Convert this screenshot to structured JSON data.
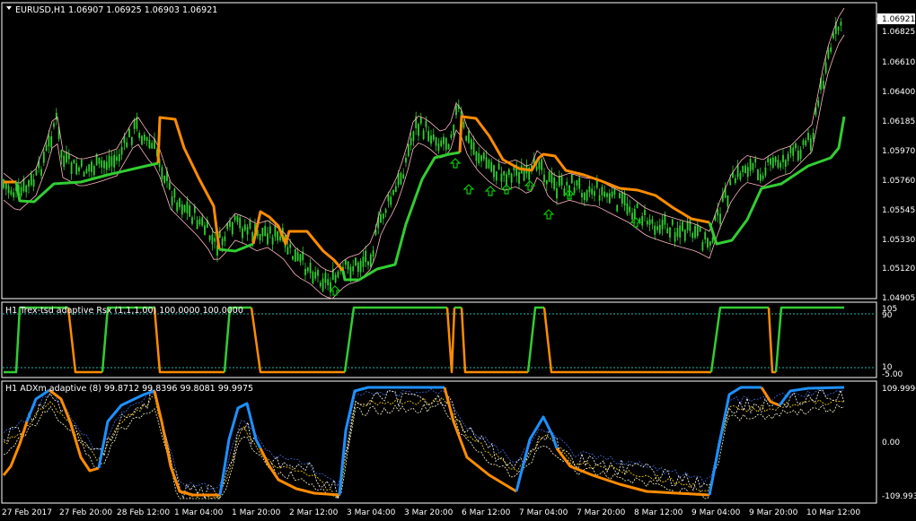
{
  "main": {
    "header": "EURUSD,H1  1.06907 1.06925 1.06903 1.06921",
    "price_labels": [
      "1.06921",
      "1.06825",
      "1.06610",
      "1.06400",
      "1.06185",
      "1.05970",
      "1.05760",
      "1.05545",
      "1.05330",
      "1.05120",
      "1.04905"
    ],
    "current_price": "1.06921"
  },
  "rsx": {
    "header": "H1 Trex-tsd adaptive Rsx (1,1,1.00) 100.0000 100.0000",
    "levels": [
      "105",
      "90",
      "10",
      "-5.00"
    ]
  },
  "adx": {
    "header": "H1 ADXm adaptive (8) 99.8712 99.8396 99.8081 99.9975",
    "levels": [
      "109.9996",
      "0.00",
      "-109.9935"
    ]
  },
  "time_axis": [
    "27 Feb 2017",
    "27 Feb 20:00",
    "28 Feb 12:00",
    "1 Mar 04:00",
    "1 Mar 20:00",
    "2 Mar 12:00",
    "3 Mar 04:00",
    "3 Mar 20:00",
    "6 Mar 12:00",
    "7 Mar 04:00",
    "7 Mar 20:00",
    "8 Mar 12:00",
    "9 Mar 04:00",
    "9 Mar 20:00",
    "10 Mar 12:00"
  ],
  "colors": {
    "background": "#000000",
    "grid": "#ffffff",
    "candle": "#32cd32",
    "trend_up": "#32cd32",
    "trend_down": "#ff8c00",
    "envelope": "#ffb6c1",
    "level_line": "#20b2aa",
    "adx_up": "#1e90ff",
    "adx_down": "#ff8c00",
    "di_a": "#ffd700",
    "di_b": "#4169e1",
    "arrow": "#00cc00"
  },
  "icons": [
    "dropdown-triangle-icon",
    "buy-arrow-icon"
  ]
}
